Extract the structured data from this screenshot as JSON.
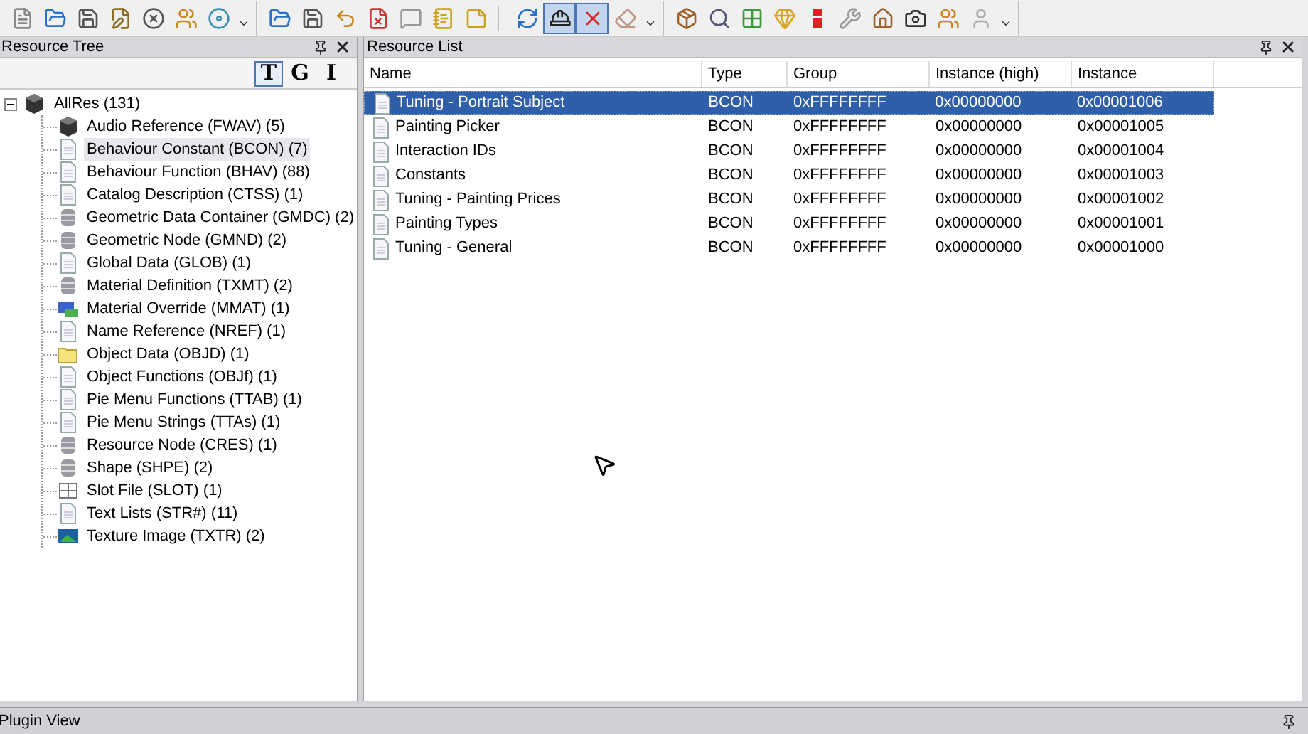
{
  "toolbar": {
    "groups": [
      {
        "kind": "overflow",
        "buttons": [
          {
            "kind": "new",
            "pressed": false
          },
          {
            "kind": "open",
            "pressed": false
          },
          {
            "kind": "save",
            "pressed": false
          },
          {
            "kind": "saveas",
            "pressed": false
          },
          {
            "kind": "close",
            "pressed": false
          },
          {
            "kind": "people",
            "pressed": false
          },
          {
            "kind": "disc",
            "pressed": false
          }
        ]
      },
      {
        "kind": "divided",
        "buttons": [
          {
            "kind": "open",
            "pressed": false
          },
          {
            "kind": "save",
            "pressed": false
          },
          {
            "kind": "undo",
            "pressed": false
          },
          {
            "kind": "notex",
            "pressed": false
          },
          {
            "kind": "comment",
            "pressed": false
          },
          {
            "kind": "notes",
            "pressed": false
          },
          {
            "kind": "note",
            "pressed": false
          }
        ]
      },
      {
        "kind": "overflow",
        "buttons": [
          {
            "kind": "refresh",
            "pressed": false
          },
          {
            "kind": "helmet",
            "pressed": true
          },
          {
            "kind": "pin",
            "pressed": true
          },
          {
            "kind": "eraser",
            "pressed": false
          }
        ]
      },
      {
        "kind": "overflow",
        "buttons": [
          {
            "kind": "box",
            "pressed": false
          },
          {
            "kind": "search",
            "pressed": false
          },
          {
            "kind": "grid",
            "pressed": false
          },
          {
            "kind": "gem",
            "pressed": false
          },
          {
            "kind": "bar",
            "pressed": false
          },
          {
            "kind": "tools",
            "pressed": false
          },
          {
            "kind": "house",
            "pressed": false
          },
          {
            "kind": "camera",
            "pressed": false
          },
          {
            "kind": "people",
            "pressed": false
          },
          {
            "kind": "user",
            "pressed": false
          }
        ]
      }
    ]
  },
  "resource_tree": {
    "title": "Resource Tree",
    "view_buttons": [
      {
        "label": "T",
        "selected": true
      },
      {
        "label": "G",
        "selected": false
      },
      {
        "label": "I",
        "selected": false
      }
    ],
    "root": {
      "label": "AllRes (131)",
      "kind": "cube",
      "expanded": true,
      "children": [
        {
          "label": "Audio Reference (FWAV) (5)",
          "kind": "cube",
          "selected": false
        },
        {
          "label": "Behaviour Constant (BCON) (7)",
          "kind": "doc",
          "selected": true
        },
        {
          "label": "Behaviour Function (BHAV) (88)",
          "kind": "doc",
          "selected": false
        },
        {
          "label": "Catalog Description (CTSS) (1)",
          "kind": "doc",
          "selected": false
        },
        {
          "label": "Geometric Data Container (GMDC) (2)",
          "kind": "db",
          "selected": false
        },
        {
          "label": "Geometric Node (GMND) (2)",
          "kind": "db",
          "selected": false
        },
        {
          "label": "Global Data (GLOB) (1)",
          "kind": "doc",
          "selected": false
        },
        {
          "label": "Material Definition (TXMT) (2)",
          "kind": "db",
          "selected": false
        },
        {
          "label": "Material Override (MMAT) (1)",
          "kind": "material",
          "selected": false
        },
        {
          "label": "Name Reference (NREF) (1)",
          "kind": "doc",
          "selected": false
        },
        {
          "label": "Object Data (OBJD) (1)",
          "kind": "folder",
          "selected": false
        },
        {
          "label": "Object Functions (OBJf) (1)",
          "kind": "doc",
          "selected": false
        },
        {
          "label": "Pie Menu Functions (TTAB) (1)",
          "kind": "doc",
          "selected": false
        },
        {
          "label": "Pie Menu Strings (TTAs) (1)",
          "kind": "doc",
          "selected": false
        },
        {
          "label": "Resource Node (CRES) (1)",
          "kind": "db",
          "selected": false
        },
        {
          "label": "Shape (SHPE) (2)",
          "kind": "db",
          "selected": false
        },
        {
          "label": "Slot File (SLOT) (1)",
          "kind": "slot",
          "selected": false
        },
        {
          "label": "Text Lists (STR#) (11)",
          "kind": "doc",
          "selected": false
        },
        {
          "label": "Texture Image (TXTR) (2)",
          "kind": "image",
          "selected": false
        }
      ]
    }
  },
  "resource_list": {
    "title": "Resource List",
    "columns": [
      "Name",
      "Type",
      "Group",
      "Instance (high)",
      "Instance"
    ],
    "rows": [
      {
        "cells": [
          "Tuning - Portrait Subject",
          "BCON",
          "0xFFFFFFFF",
          "0x00000000",
          "0x00001006"
        ],
        "selected": true
      },
      {
        "cells": [
          "Painting Picker",
          "BCON",
          "0xFFFFFFFF",
          "0x00000000",
          "0x00001005"
        ],
        "selected": false
      },
      {
        "cells": [
          "Interaction IDs",
          "BCON",
          "0xFFFFFFFF",
          "0x00000000",
          "0x00001004"
        ],
        "selected": false
      },
      {
        "cells": [
          "Constants",
          "BCON",
          "0xFFFFFFFF",
          "0x00000000",
          "0x00001003"
        ],
        "selected": false
      },
      {
        "cells": [
          "Tuning - Painting Prices",
          "BCON",
          "0xFFFFFFFF",
          "0x00000000",
          "0x00001002"
        ],
        "selected": false
      },
      {
        "cells": [
          "Painting Types",
          "BCON",
          "0xFFFFFFFF",
          "0x00000000",
          "0x00001001"
        ],
        "selected": false
      },
      {
        "cells": [
          "Tuning - General",
          "BCON",
          "0xFFFFFFFF",
          "0x00000000",
          "0x00001000"
        ],
        "selected": false
      }
    ]
  },
  "plugin_view": {
    "title": "Plugin View"
  }
}
